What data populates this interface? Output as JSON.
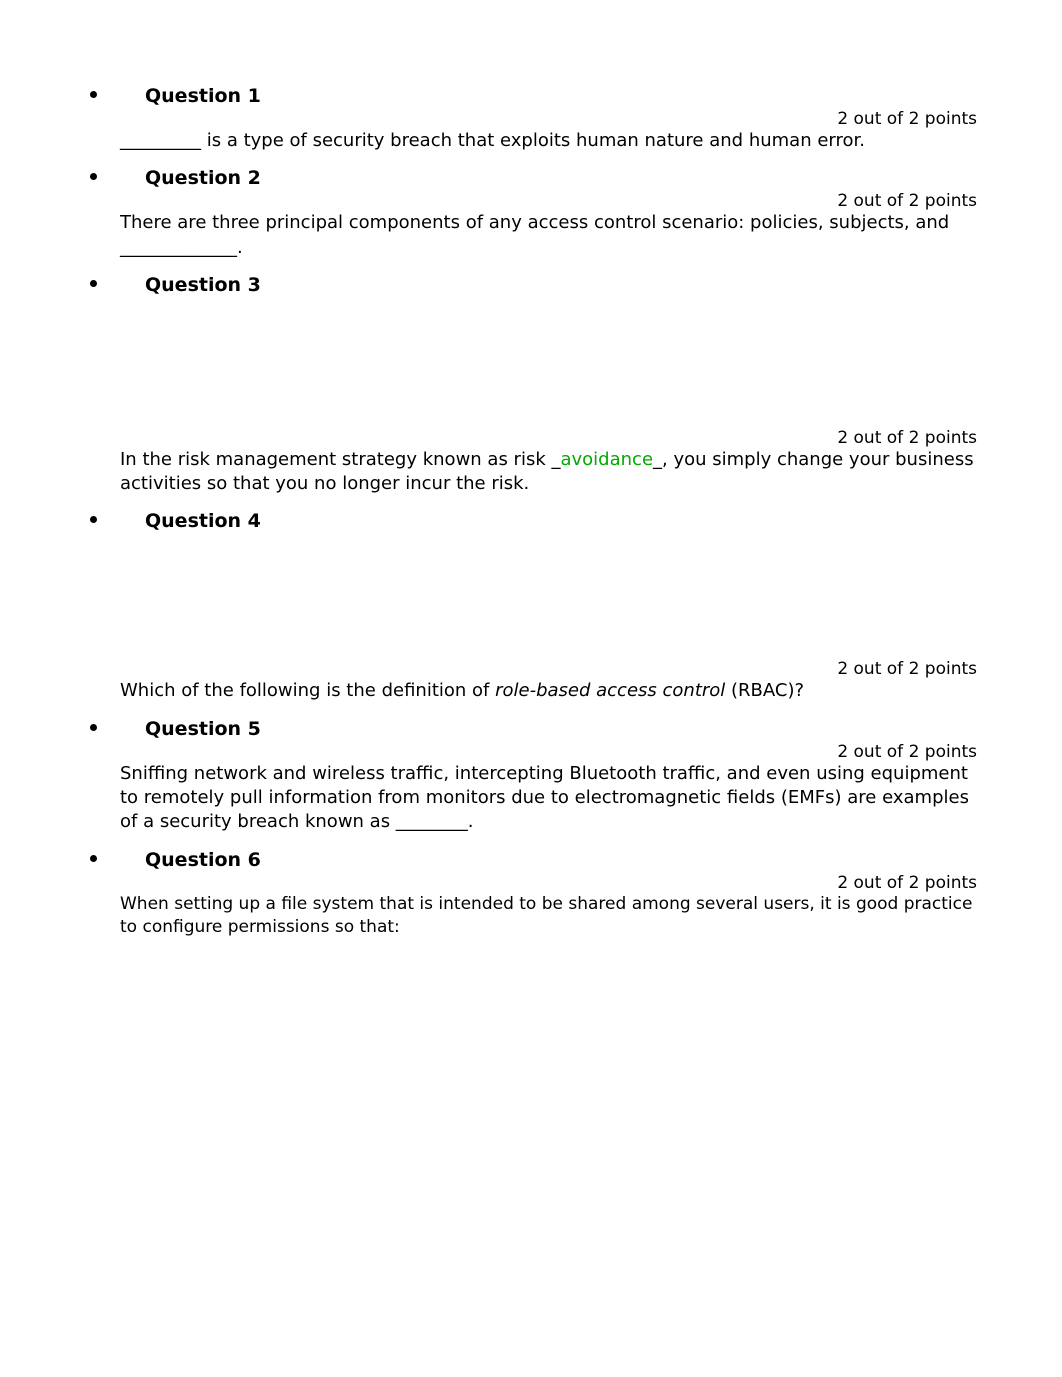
{
  "questions": [
    {
      "number": "Question 1",
      "points": "2 out of 2 points",
      "body_pre": "_________ is a type of security breach that exploits human nature and human error.",
      "gap_before_points": "none"
    },
    {
      "number": "Question 2",
      "points": "2 out of 2 points",
      "body_pre": "There are three principal components of any access control scenario: policies, subjects, and _____________.",
      "gap_before_points": "none"
    },
    {
      "number": "Question 3",
      "points": "2 out of 2 points",
      "body_pre": "In the risk management strategy known as risk _",
      "answer": "avoidance",
      "body_post": "_, you simply change your business activities so that you no longer incur the risk.",
      "gap_before_points": "large"
    },
    {
      "number": "Question 4",
      "points": "2 out of 2 points",
      "body_pre": "Which of the following is the definition of ",
      "italic": "role-based access control",
      "body_post": " (RBAC)?",
      "gap_before_points": "medium"
    },
    {
      "number": "Question 5",
      "points": "2 out of 2 points",
      "body_pre": "Sniffing network and wireless traffic, intercepting Bluetooth traffic, and even using equipment to remotely pull information from monitors due to electromagnetic fields (EMFs) are examples of a security breach known as ________.",
      "gap_before_points": "none"
    },
    {
      "number": "Question 6",
      "points": "2 out of 2 points",
      "body_pre": "When setting up a file system that is intended to be shared among several users, it is good practice to configure permissions so that:",
      "gap_before_points": "none",
      "body_class": "q6-body"
    }
  ]
}
